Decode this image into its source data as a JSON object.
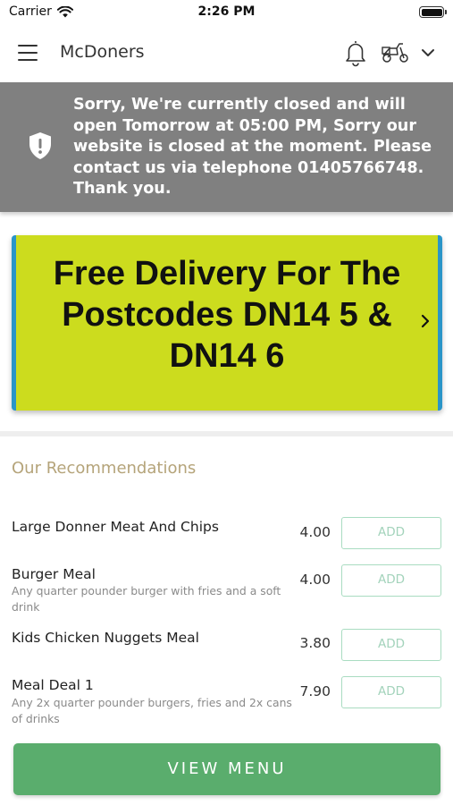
{
  "status_bar": {
    "carrier": "Carrier",
    "time": "2:26 PM"
  },
  "header": {
    "title": "McDoners"
  },
  "closed_notice": {
    "text": "Sorry, We're currently closed and will open Tomorrow at 05:00 PM, Sorry our website is closed at the moment. Please contact us via telephone 01405766748. Thank you."
  },
  "promo": {
    "text": "Free Delivery For The Postcodes DN14 5 & DN14 6",
    "background": "#ccdc1e",
    "edge_color": "#2a95c8"
  },
  "recommendations": {
    "heading": "Our Recommendations",
    "items": [
      {
        "name": "Large Donner Meat And Chips",
        "description": "",
        "price": "4.00",
        "add_label": "ADD"
      },
      {
        "name": "Burger Meal",
        "description": "Any quarter pounder burger with fries and a  soft drink",
        "price": "4.00",
        "add_label": "ADD"
      },
      {
        "name": "Kids Chicken Nuggets Meal",
        "description": "",
        "price": "3.80",
        "add_label": "ADD"
      },
      {
        "name": "Meal Deal 1",
        "description": "Any 2x quarter pounder burgers, fries and 2x cans of drinks",
        "price": "7.90",
        "add_label": "ADD"
      }
    ]
  },
  "view_menu": {
    "label": "VIEW MENU",
    "color": "#5aad6d"
  },
  "icons": [
    "wifi-icon",
    "battery-icon",
    "hamburger-menu-icon",
    "bell-icon",
    "scooter-icon",
    "chevron-down-icon",
    "shield-alert-icon",
    "chevron-right-icon"
  ]
}
